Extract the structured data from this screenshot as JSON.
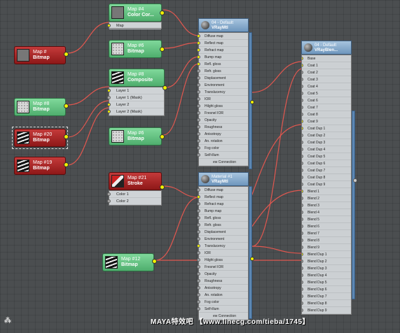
{
  "nodes": {
    "map4": {
      "num": "Map #4",
      "type": "Color Cor...",
      "inputs": [
        "Map"
      ]
    },
    "map6a": {
      "num": "Map #6",
      "type": "Bitmap"
    },
    "map8": {
      "num": "Map #8",
      "type": "Composite",
      "inputs": [
        "Layer 1",
        "Layer 1 (Mask)",
        "Layer 2",
        "Layer 2 (Mask)"
      ]
    },
    "map6b": {
      "num": "Map #6",
      "type": "Bitmap"
    },
    "map21": {
      "num": "Map #21",
      "type": "Stroke",
      "inputs": [
        "Color 1",
        "Color 2"
      ]
    },
    "map12": {
      "num": "Map #12",
      "type": "Bitmap"
    },
    "redtop": {
      "num": "Map #",
      "type": "Bitmap"
    },
    "map8b": {
      "num": "Map #8",
      "type": "Bitmap"
    },
    "map20": {
      "num": "Map #20",
      "type": "Bitmap"
    },
    "map19": {
      "num": "Map #19",
      "type": "Bitmap"
    }
  },
  "vray1": {
    "line1": "04 - Default",
    "line2": "VRayMtl",
    "footer": "ew Connection",
    "params": [
      "Diffuse map",
      "Reflect map",
      "Refract map",
      "Bump map",
      "Refl. gloss",
      "Refr. gloss",
      "Displacement",
      "Environment",
      "Translucency",
      "IOR",
      "Hilght gloss",
      "Fresnel IOR",
      "Opacity",
      "Roughness",
      "Anisotropy",
      "An. rotation",
      "Fog color",
      "Self-illum"
    ]
  },
  "vray2": {
    "line1": "Material #1",
    "line2": "VRayMtl",
    "footer": "ew Connection",
    "params": [
      "Diffuse map",
      "Reflect map",
      "Refract map",
      "Bump map",
      "Refl. gloss",
      "Refr. gloss",
      "Displacement",
      "Environment",
      "Translucency",
      "IOR",
      "Hilght gloss",
      "Fresnel IOR",
      "Opacity",
      "Roughness",
      "Anisotropy",
      "An. rotation",
      "Fog color",
      "Self-illum"
    ]
  },
  "blend": {
    "line1": "04 - Default",
    "line2": "VRayBlen...",
    "params": [
      "Base",
      "Coat 1",
      "Coat 2",
      "Coat 3",
      "Coat 4",
      "Coat 5",
      "Coat 6",
      "Coat 7",
      "Coat 8",
      "Coat 9",
      "Coat Dup 1",
      "Coat Dup 2",
      "Coat Dup 3",
      "Coat Dup 4",
      "Coat Dup 5",
      "Coat Dup 6",
      "Coat Dup 7",
      "Coat Dup 8",
      "Coat Dup 9",
      "Blend 1",
      "Blend 2",
      "Blend 3",
      "Blend 4",
      "Blend 5",
      "Blend 6",
      "Blend 7",
      "Blend 8",
      "Blend 9",
      "Blend Dup 1",
      "Blend Dup 2",
      "Blend Dup 3",
      "Blend Dup 4",
      "Blend Dup 5",
      "Blend Dup 6",
      "Blend Dup 7",
      "Blend Dup 8",
      "Blend Dup 9"
    ]
  },
  "watermark": "MAYA特效吧  【www.linecg.com/tieba/1745】",
  "colors": {
    "wire": "#e0574f",
    "map_node": "#5cbf7d",
    "vray_header": "#8aafd3",
    "pin_active": "#f0f000",
    "background": "#4b4e50"
  }
}
